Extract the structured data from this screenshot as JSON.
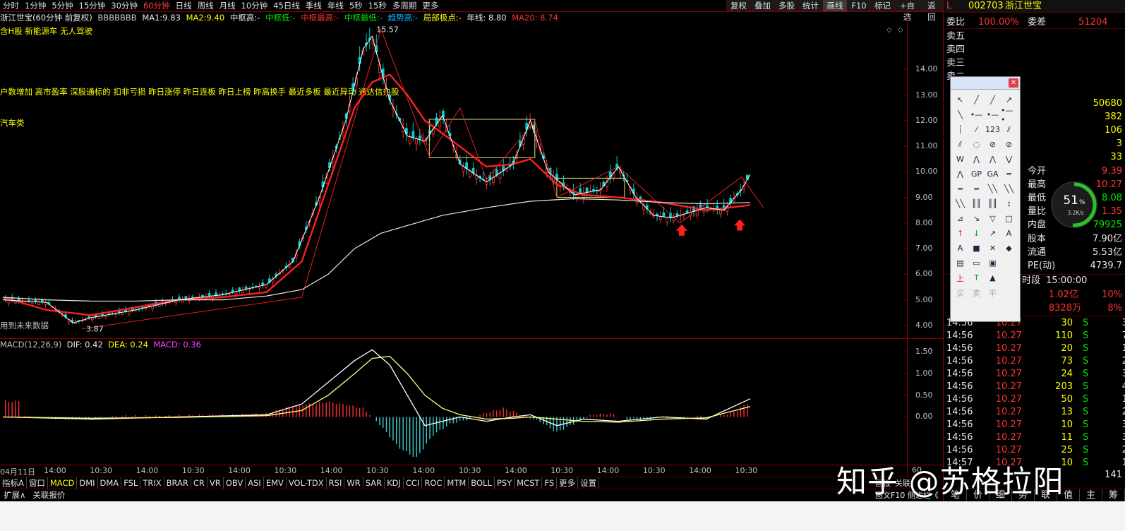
{
  "toolbar": {
    "periods": [
      "分时",
      "1分钟",
      "5分钟",
      "15分钟",
      "30分钟",
      "60分钟",
      "日线",
      "周线",
      "月线",
      "10分钟",
      "45日线",
      "季线",
      "年线",
      "5秒",
      "15秒",
      "多周期",
      "更多"
    ],
    "active_period": "60分钟",
    "right_buttons": [
      "复权",
      "叠加",
      "多股",
      "统计",
      "画线",
      "F10",
      "标记",
      "+自选",
      "返回"
    ]
  },
  "info": {
    "title": "浙江世宝(60分钟 前复权)",
    "formula": "BBBBBBB",
    "ma1_label": "MA1:",
    "ma1_val": "9.83",
    "ma2_label": "MA2:",
    "ma2_val": "9.40",
    "zsg": "中枢高:-",
    "zsd": "中枢低:-",
    "zsmax": "中枢最高:-",
    "zsmin": "中枢最低:-",
    "trend": "趋势高:-",
    "jbjd": "局部极点:-",
    "yearline": "年线: 8.80",
    "ma20": "MA20: 8.74",
    "concepts": "含H股 新能源车 无人驾驶",
    "notice": "户数增加 高市盈率 深股通标的 扣非亏损 昨日涨停 昨日连板 昨日上榜 昨高换手 最近多板 最近异动 通达信热股",
    "sector": "汽车类",
    "future_note": "用到未来数据"
  },
  "chart_data": [
    {
      "type": "line",
      "title": "浙江世宝(60分钟 前复权)",
      "ylim": [
        3.5,
        15.8
      ],
      "y_ticks": [
        4.0,
        5.0,
        6.0,
        7.0,
        8.0,
        9.0,
        10.0,
        11.0,
        12.0,
        13.0,
        14.0
      ],
      "x_ticks": [
        "04月11日",
        "14:00",
        "10:30",
        "14:00",
        "10:30",
        "14:00",
        "10:30",
        "14:00",
        "10:30",
        "14:00",
        "10:30",
        "14:00",
        "10:30",
        "14:00",
        "10:30",
        "14:00",
        "10:30"
      ],
      "annotations": [
        {
          "label": "15.57",
          "x": 42,
          "y": 15.57
        },
        {
          "label": "3.87",
          "x": 9,
          "y": 3.87
        }
      ],
      "series": [
        {
          "name": "MA20",
          "color": "#ff2020",
          "x": [
            0,
            5,
            10,
            15,
            20,
            25,
            30,
            34,
            37,
            40,
            42,
            44,
            46,
            48,
            50,
            55,
            58,
            60,
            63,
            66,
            70,
            75,
            80,
            85
          ],
          "y": [
            5.1,
            4.6,
            4.4,
            4.7,
            5.0,
            5.1,
            5.3,
            6.5,
            9.5,
            12.5,
            13.5,
            13.8,
            13.0,
            12.0,
            11.5,
            10.2,
            10.3,
            10.5,
            9.5,
            9.1,
            9.0,
            8.8,
            8.5,
            8.7
          ]
        },
        {
          "name": "年线",
          "color": "#e8e8e8",
          "x": [
            0,
            5,
            10,
            15,
            20,
            25,
            30,
            34,
            37,
            40,
            43,
            46,
            50,
            55,
            60,
            65,
            70,
            75,
            80,
            85
          ],
          "y": [
            5.1,
            5.0,
            4.95,
            4.95,
            5.0,
            5.0,
            5.15,
            5.4,
            6.0,
            7.0,
            7.6,
            7.9,
            8.3,
            8.6,
            8.85,
            8.95,
            8.9,
            8.8,
            8.75,
            8.8
          ]
        },
        {
          "name": "MA1",
          "color": "#ffffff",
          "x": [
            0,
            5,
            8,
            10,
            15,
            20,
            25,
            30,
            33,
            36,
            39,
            41,
            42,
            43,
            44,
            46,
            48,
            50,
            52,
            55,
            58,
            60,
            62,
            65,
            68,
            70,
            72,
            74,
            76,
            78,
            80,
            82,
            84,
            85
          ],
          "y": [
            5.0,
            4.9,
            4.1,
            4.3,
            4.6,
            5.0,
            5.2,
            5.6,
            6.5,
            9.0,
            12.0,
            14.8,
            15.3,
            14.0,
            12.8,
            11.4,
            11.2,
            12.2,
            10.3,
            9.6,
            10.3,
            12.0,
            10.0,
            9.1,
            9.3,
            10.2,
            9.0,
            8.3,
            8.2,
            8.4,
            8.6,
            8.5,
            9.3,
            9.9
          ]
        }
      ]
    },
    {
      "type": "bar",
      "title": "MACD(12,26,9)",
      "ylim": [
        -1.1,
        1.8
      ],
      "y_ticks": [
        0.0,
        0.5,
        1.0,
        1.5
      ],
      "params": {
        "DIF": 0.42,
        "DEA": 0.24,
        "MACD": 0.36
      },
      "series": [
        {
          "name": "DIF",
          "color": "#ffffff",
          "x": [
            0,
            10,
            20,
            30,
            34,
            37,
            40,
            42,
            44,
            46,
            48,
            50,
            52,
            55,
            58,
            60,
            63,
            66,
            70,
            75,
            80,
            85
          ],
          "y": [
            0.0,
            -0.05,
            0.0,
            0.05,
            0.3,
            0.8,
            1.3,
            1.55,
            1.2,
            0.5,
            -0.2,
            -0.1,
            0.0,
            -0.1,
            0.0,
            0.05,
            -0.2,
            -0.05,
            -0.1,
            0.0,
            -0.05,
            0.42
          ]
        },
        {
          "name": "DEA",
          "color": "#ffff80",
          "x": [
            0,
            10,
            20,
            30,
            34,
            37,
            40,
            42,
            44,
            46,
            48,
            50,
            52,
            55,
            58,
            60,
            63,
            66,
            70,
            75,
            80,
            85
          ],
          "y": [
            0.0,
            -0.03,
            -0.01,
            0.03,
            0.15,
            0.5,
            1.0,
            1.35,
            1.4,
            1.0,
            0.5,
            0.2,
            0.05,
            -0.05,
            -0.03,
            0.0,
            -0.05,
            -0.1,
            -0.12,
            -0.05,
            -0.02,
            0.24
          ]
        },
        {
          "name": "MACD",
          "color": "#ff3030",
          "x": [
            2,
            6,
            10,
            14,
            18,
            22,
            26,
            30,
            33,
            35,
            37,
            39,
            41,
            43,
            45,
            47,
            49,
            51,
            53,
            55,
            57,
            59,
            61,
            63,
            65,
            67,
            69,
            71,
            73,
            75,
            77,
            79,
            81,
            83,
            85
          ],
          "y": [
            0.02,
            -0.04,
            -0.02,
            0.03,
            0.02,
            0.04,
            0.05,
            0.08,
            0.25,
            0.3,
            0.35,
            0.28,
            0.2,
            -0.2,
            -0.7,
            -0.95,
            -0.4,
            -0.15,
            -0.05,
            0.1,
            0.2,
            0.05,
            -0.1,
            -0.35,
            -0.15,
            0.05,
            0.08,
            -0.05,
            -0.06,
            0.02,
            -0.02,
            0.02,
            0.0,
            0.1,
            0.36
          ]
        }
      ]
    }
  ],
  "markers": {
    "up_arrow_color": "#ff2020"
  },
  "bottom_tabs": [
    "指标A",
    "窗口",
    "MACD",
    "DMI",
    "DMA",
    "FSL",
    "TRIX",
    "BRAR",
    "CR",
    "VR",
    "OBV",
    "ASI",
    "EMV",
    "VOL-TDX",
    "RSI",
    "WR",
    "SAR",
    "KDJ",
    "CCI",
    "ROC",
    "MTM",
    "BOLL",
    "PSY",
    "MCST",
    "FS",
    "更多",
    "设置"
  ],
  "active_tab": "MACD",
  "ext_tabs": [
    "扩展∧",
    "关联报价"
  ],
  "right_panel": {
    "code": "002703",
    "name": "浙江世宝",
    "tag": "L",
    "weibi_label": "委比",
    "weibi_val": "100.00%",
    "weicha_label": "委差",
    "weicha_val": "51204",
    "sell_labels": [
      "卖五",
      "卖四",
      "卖三",
      "卖二"
    ],
    "vol_vals": [
      "50680",
      "382",
      "106",
      "3",
      "33"
    ],
    "jinkai_label": "今开",
    "jinkai_val": "9.39",
    "zuigao_label": "最高",
    "zuigao_val": "10.27",
    "zuidi_label": "最低",
    "zuidi_val": "8.08",
    "liangbi_label": "量比",
    "liangbi_val": "1.35",
    "neipan_label": "内盘",
    "neipan_val": "79925",
    "guben_label": "股本",
    "guben_val": "7.90亿",
    "liutong_label": "流通",
    "liutong_val": "5.53亿",
    "pe_label": "PE(动)",
    "pe_val": "4739.7",
    "shiduan_label": "时段",
    "shiduan_val": "15:00:00",
    "amount1": "1.02亿",
    "pct1": "10%",
    "amount2": "8328万",
    "pct2": "8%",
    "ticks": [
      {
        "time": "14:56",
        "price": "10.27",
        "vol": "30",
        "side": "S",
        "n": "3"
      },
      {
        "time": "14:56",
        "price": "10.27",
        "vol": "110",
        "side": "S",
        "n": "7"
      },
      {
        "time": "14:56",
        "price": "10.27",
        "vol": "20",
        "side": "S",
        "n": "1"
      },
      {
        "time": "14:56",
        "price": "10.27",
        "vol": "73",
        "side": "S",
        "n": "2"
      },
      {
        "time": "14:56",
        "price": "10.27",
        "vol": "24",
        "side": "S",
        "n": "3"
      },
      {
        "time": "14:56",
        "price": "10.27",
        "vol": "203",
        "side": "S",
        "n": "4"
      },
      {
        "time": "14:56",
        "price": "10.27",
        "vol": "50",
        "side": "S",
        "n": "1"
      },
      {
        "time": "14:56",
        "price": "10.27",
        "vol": "13",
        "side": "S",
        "n": "2"
      },
      {
        "time": "14:56",
        "price": "10.27",
        "vol": "10",
        "side": "S",
        "n": "3"
      },
      {
        "time": "14:56",
        "price": "10.27",
        "vol": "11",
        "side": "S",
        "n": "3"
      },
      {
        "time": "14:56",
        "price": "10.27",
        "vol": "25",
        "side": "S",
        "n": "2"
      },
      {
        "time": "14:57",
        "price": "10.27",
        "vol": "10",
        "side": "S",
        "n": "1"
      }
    ],
    "extra_num": "141",
    "bottom_btns": [
      "笔",
      "价",
      "细",
      "势",
      "联",
      "值",
      "主",
      "筹"
    ],
    "side_note": "图文F10 侧边栏《"
  },
  "gauge": {
    "pct": "51",
    "unit": "%",
    "rate": "3.2K/s"
  },
  "toolbox": {
    "tools": [
      "↖",
      "╱",
      "╱",
      "↗",
      "╲",
      "•—",
      "•—",
      "•—•",
      "┆",
      "⁄",
      "123",
      "⫽",
      "⫽",
      "◌",
      "⊘",
      "⊘",
      "W",
      "⋀",
      "⋀",
      "⋁",
      "⋀",
      "GP",
      "GA",
      "═",
      "═",
      "═",
      "╲╲",
      "╲╲",
      "╲╲",
      "║║",
      "║║",
      "⦂",
      "⊿",
      "↘",
      "▽",
      "□",
      "↑",
      "↓",
      "↗",
      "A",
      "A",
      "■",
      "✕",
      "◆",
      "▤",
      "▭",
      "▣",
      "",
      "上",
      "T",
      "▲",
      "",
      "买",
      "卖",
      "平",
      ""
    ]
  },
  "watermark": "知乎 @苏格拉阳",
  "fav_buttons": [
    "画板",
    "关联"
  ],
  "page_num": "60"
}
